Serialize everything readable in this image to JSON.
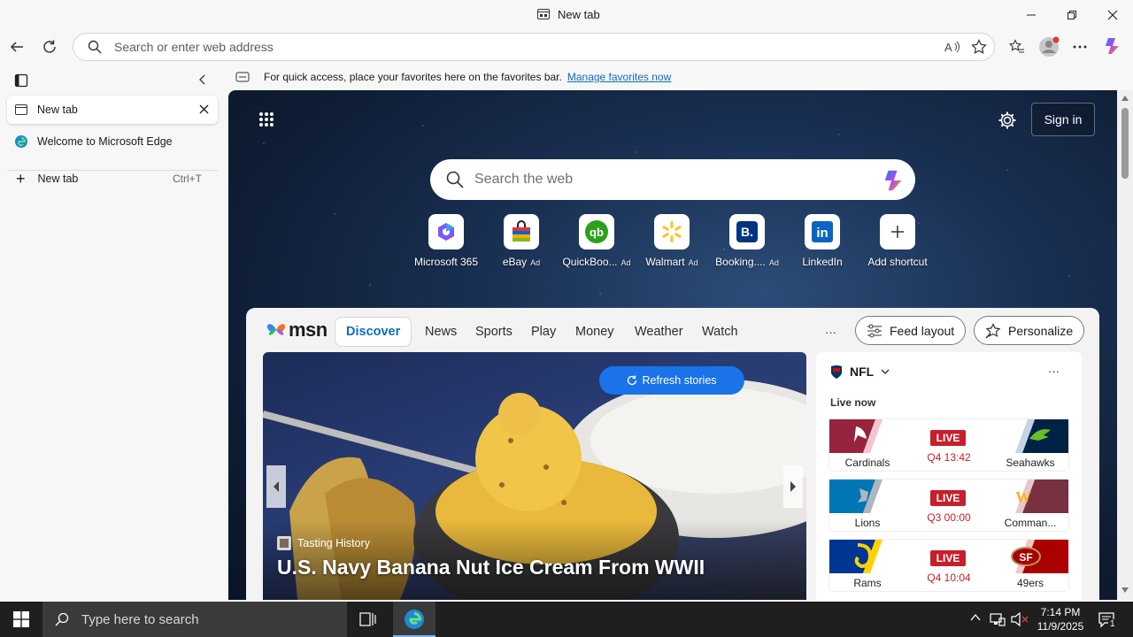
{
  "window": {
    "title": "New tab"
  },
  "address_bar": {
    "placeholder": "Search or enter web address"
  },
  "favorites_bar": {
    "message": "For quick access, place your favorites here on the favorites bar.",
    "link": "Manage favorites now"
  },
  "sidebar": {
    "tabs": [
      {
        "label": "New tab",
        "active": true
      },
      {
        "label": "Welcome to Microsoft Edge",
        "active": false
      }
    ],
    "new_tab": {
      "label": "New tab",
      "shortcut": "Ctrl+T"
    }
  },
  "ntp": {
    "sign_in": "Sign in",
    "search_placeholder": "Search the web",
    "shortcuts": [
      {
        "label": "Microsoft 365",
        "ad": ""
      },
      {
        "label": "eBay",
        "ad": "Ad"
      },
      {
        "label": "QuickBoo...",
        "ad": "Ad"
      },
      {
        "label": "Walmart",
        "ad": "Ad"
      },
      {
        "label": "Booking....",
        "ad": "Ad"
      },
      {
        "label": "LinkedIn",
        "ad": ""
      },
      {
        "label": "Add shortcut",
        "ad": ""
      }
    ]
  },
  "msn": {
    "logo": "msn",
    "nav": [
      "Discover",
      "News",
      "Sports",
      "Play",
      "Money",
      "Weather",
      "Watch"
    ],
    "more": "···",
    "feed_layout": "Feed layout",
    "personalize": "Personalize",
    "refresh": "Refresh stories",
    "hero": {
      "source": "Tasting History",
      "title": "U.S. Navy Banana Nut Ice Cream From WWII"
    },
    "nfl": {
      "title": "NFL",
      "live_now": "Live now",
      "more": "···",
      "games": [
        {
          "home": "Cardinals",
          "away": "Seahawks",
          "status": "LIVE",
          "clock": "Q4 13:42",
          "home_color": "#97233f",
          "away_color": "#002244"
        },
        {
          "home": "Lions",
          "away": "Comman...",
          "status": "LIVE",
          "clock": "Q3 00:00",
          "home_color": "#0076b6",
          "away_color": "#773141"
        },
        {
          "home": "Rams",
          "away": "49ers",
          "status": "LIVE",
          "clock": "Q4 10:04",
          "home_color": "#003594",
          "away_color": "#aa0000"
        }
      ]
    }
  },
  "taskbar": {
    "search_placeholder": "Type here to search",
    "time": "7:14 PM",
    "date": "11/9/2025",
    "notifications": "1"
  },
  "colors": {
    "accent": "#0f6cbd",
    "live": "#c5202b",
    "refresh": "#1a73e8"
  }
}
